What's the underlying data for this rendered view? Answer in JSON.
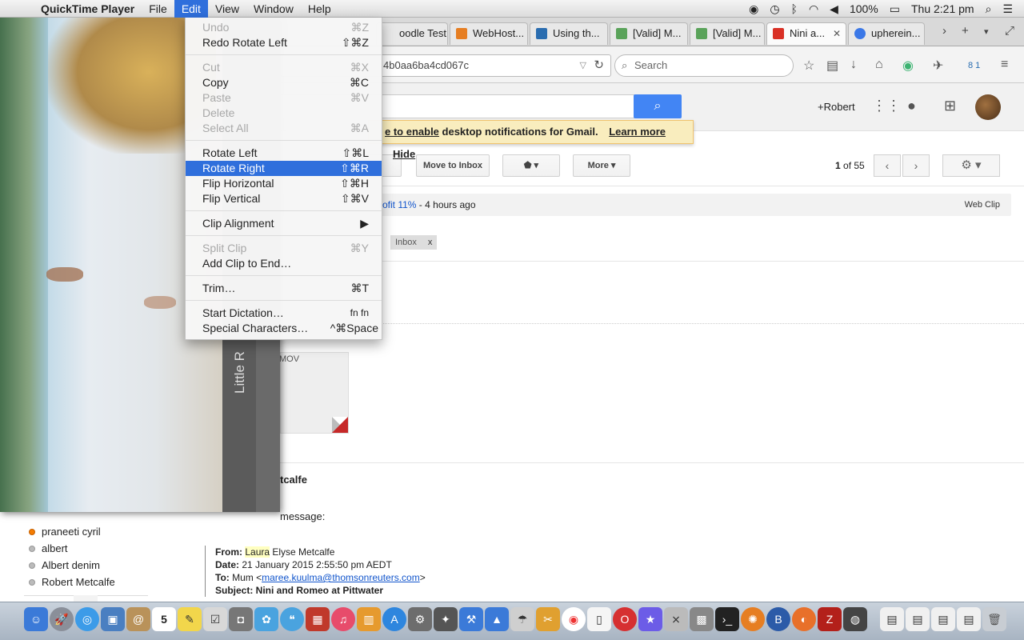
{
  "menubar": {
    "app_name": "QuickTime Player",
    "menus": [
      "File",
      "Edit",
      "View",
      "Window",
      "Help"
    ],
    "battery": "100%",
    "clock": "Thu 2:21 pm"
  },
  "edit_menu": {
    "items": [
      {
        "label": "Undo",
        "shortcut": "⌘Z",
        "enabled": false
      },
      {
        "label": "Redo Rotate Left",
        "shortcut": "⇧⌘Z",
        "enabled": true
      },
      {
        "label": "Cut",
        "shortcut": "⌘X",
        "enabled": false
      },
      {
        "label": "Copy",
        "shortcut": "⌘C",
        "enabled": true
      },
      {
        "label": "Paste",
        "shortcut": "⌘V",
        "enabled": false
      },
      {
        "label": "Delete",
        "shortcut": "",
        "enabled": false
      },
      {
        "label": "Select All",
        "shortcut": "⌘A",
        "enabled": false
      },
      {
        "label": "Rotate Left",
        "shortcut": "⇧⌘L",
        "enabled": true
      },
      {
        "label": "Rotate Right",
        "shortcut": "⇧⌘R",
        "enabled": true,
        "highlighted": true
      },
      {
        "label": "Flip Horizontal",
        "shortcut": "⇧⌘H",
        "enabled": true
      },
      {
        "label": "Flip Vertical",
        "shortcut": "⇧⌘V",
        "enabled": true
      },
      {
        "label": "Clip Alignment",
        "shortcut": "▶",
        "enabled": true
      },
      {
        "label": "Split Clip",
        "shortcut": "⌘Y",
        "enabled": false
      },
      {
        "label": "Add Clip to End…",
        "shortcut": "",
        "enabled": true
      },
      {
        "label": "Trim…",
        "shortcut": "⌘T",
        "enabled": true
      },
      {
        "label": "Start Dictation…",
        "shortcut": "fn fn",
        "enabled": true
      },
      {
        "label": "Special Characters…",
        "shortcut": "^⌘Space",
        "enabled": true
      }
    ]
  },
  "quicktime": {
    "title_fragment": "Little R"
  },
  "browser": {
    "tabs": [
      {
        "label": "oodle Test ...",
        "fav_color": "#e67e22"
      },
      {
        "label": "WebHost...",
        "fav_color": "#e67e22"
      },
      {
        "label": "Using th...",
        "fav_color": "#2a6db0"
      },
      {
        "label": "[Valid] M...",
        "fav_color": "#5aa35a"
      },
      {
        "label": "[Valid] M...",
        "fav_color": "#5aa35a"
      },
      {
        "label": "Nini a...",
        "fav_color": "#d93025",
        "active": true
      },
      {
        "label": "upherein...",
        "fav_color": "#3b78e7"
      }
    ],
    "url_fragment": "4b0aa6ba4cd067c",
    "search_placeholder": "Search",
    "toolbar_badge": "8 1"
  },
  "gmail": {
    "account_name": "+Robert",
    "notification": {
      "text_prefix": "e to enable",
      "text_rest": " desktop notifications for Gmail.",
      "learn_more": "Learn more",
      "hide": "Hide"
    },
    "buttons": {
      "move_to_inbox": "Move to Inbox",
      "more": "More ▾",
      "labels": "▾"
    },
    "pager": {
      "current": "1",
      "of": " of ",
      "total": "55"
    },
    "webclip": {
      "link": "rofit 11%",
      "time": " - 4 hours ago",
      "right": "Web Clip"
    },
    "label_chip": {
      "name": "Inbox",
      "x": "x"
    },
    "attachment_ext": "MOV",
    "sender_fragment": "tcalfe",
    "forward_fragment": "message:",
    "quote": {
      "from_label": "From:",
      "from_first": "Laura",
      "from_rest": " Elyse Metcalfe",
      "date_label": "Date:",
      "date_value": " 21 January 2015 2:55:50 pm AEDT",
      "to_label": "To:",
      "to_name": " Mum <",
      "to_email": "maree.kuulma@thomsonreuters.com",
      "to_end": ">",
      "subject_label": "Subject:",
      "subject_value": " Nini and Romeo at Pittwater"
    },
    "contacts": [
      {
        "name": "praneeti cyril",
        "status": "away"
      },
      {
        "name": "albert",
        "status": "offline"
      },
      {
        "name": "Albert denim",
        "status": "offline"
      },
      {
        "name": "Robert Metcalfe",
        "status": "offline"
      }
    ]
  },
  "dock": {
    "calendar_day": "5"
  }
}
